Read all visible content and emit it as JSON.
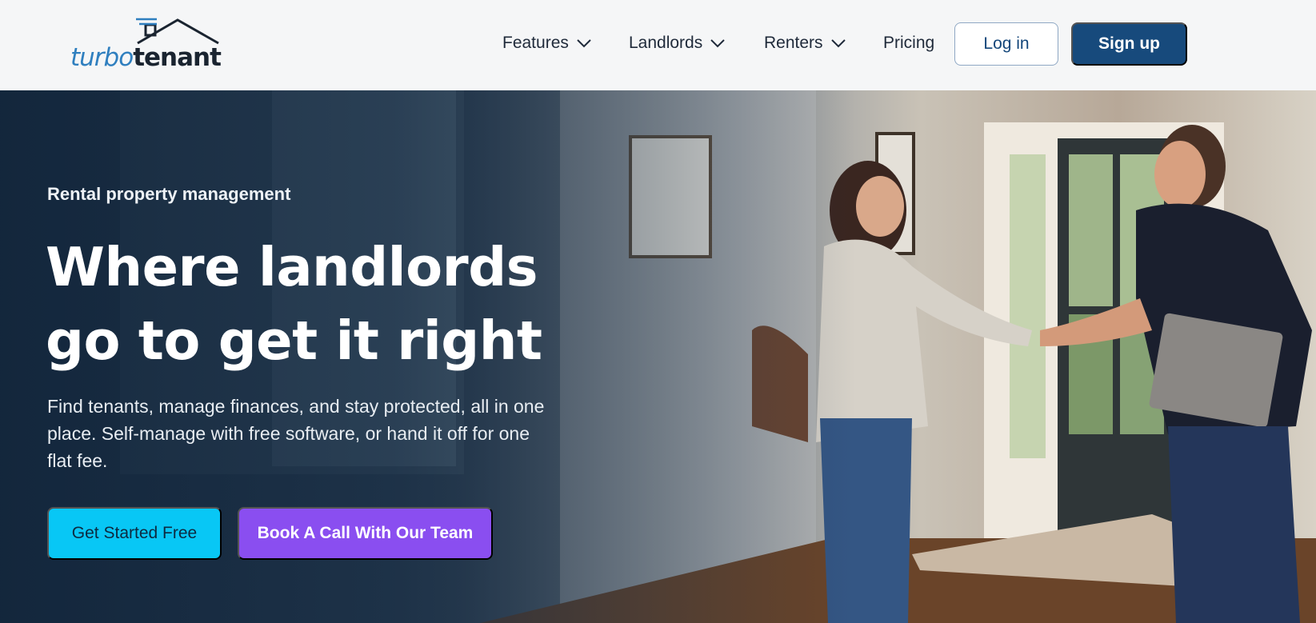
{
  "brand": {
    "logo_part1": "turbo",
    "logo_part2": "tenant"
  },
  "nav": {
    "items": [
      {
        "label": "Features",
        "dropdown": true
      },
      {
        "label": "Landlords",
        "dropdown": true
      },
      {
        "label": "Renters",
        "dropdown": true
      },
      {
        "label": "Pricing",
        "dropdown": false
      }
    ],
    "login_label": "Log in",
    "signup_label": "Sign up"
  },
  "hero": {
    "eyebrow": "Rental property management",
    "headline": "Where landlords go to get it right",
    "subtext": "Find tenants, manage finances, and stay protected, all in one place. Self-manage with free software, or hand it off for one flat fee.",
    "primary_cta": "Get Started Free",
    "secondary_cta": "Book A Call With Our Team"
  },
  "colors": {
    "header_bg": "#f5f6f7",
    "brand_blue": "#174a7c",
    "cta_cyan": "#08c7f5",
    "cta_purple": "#8a4ef0"
  },
  "icons": {
    "logo": "house-roof-logo",
    "nav_dropdown": "chevron-down-icon"
  }
}
